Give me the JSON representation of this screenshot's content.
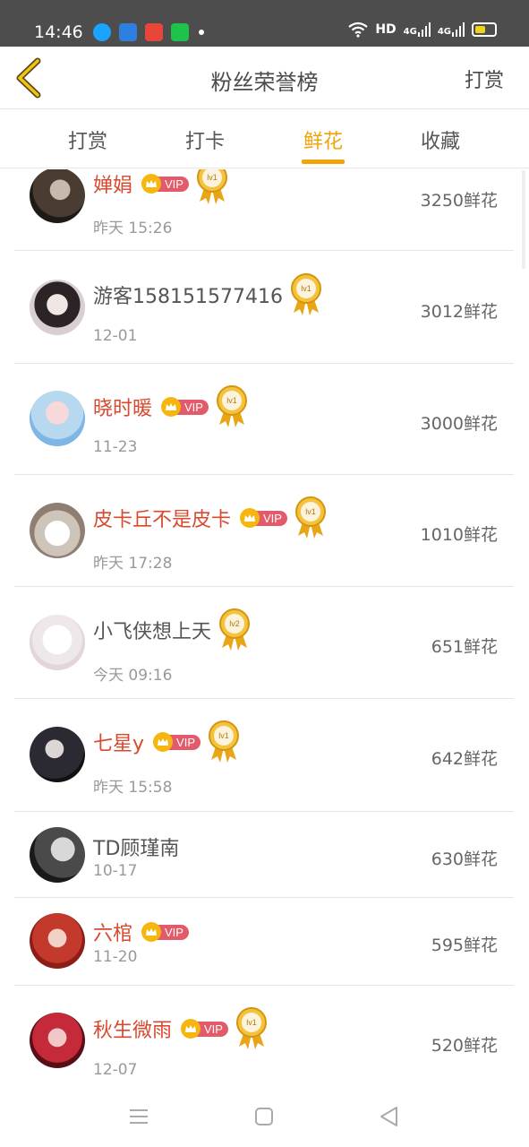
{
  "status_bar": {
    "time": "14:46",
    "hd_label": "HD",
    "net1": "4G",
    "net2": "4G"
  },
  "nav": {
    "title": "粉丝荣誉榜",
    "action_label": "打赏"
  },
  "tabs": [
    {
      "label": "打赏",
      "active": false
    },
    {
      "label": "打卡",
      "active": false
    },
    {
      "label": "鲜花",
      "active": true
    },
    {
      "label": "收藏",
      "active": false
    }
  ],
  "vip_label": "VIP",
  "rows": [
    {
      "name": "婵娟",
      "vip": true,
      "level": "lv1",
      "date": "昨天 15:26",
      "amount": "3250鲜花"
    },
    {
      "name": "游客158151577416",
      "vip": false,
      "level": "lv1",
      "date": "12-01",
      "amount": "3012鲜花"
    },
    {
      "name": "晓时暖",
      "vip": true,
      "level": "lv1",
      "date": "11-23",
      "amount": "3000鲜花"
    },
    {
      "name": "皮卡丘不是皮卡",
      "vip": true,
      "level": "lv1",
      "date": "昨天 17:28",
      "amount": "1010鲜花"
    },
    {
      "name": "小飞侠想上天",
      "vip": false,
      "level": "lv2",
      "date": "今天 09:16",
      "amount": "651鲜花"
    },
    {
      "name": "七星y",
      "vip": true,
      "level": "lv1",
      "date": "昨天 15:58",
      "amount": "642鲜花"
    },
    {
      "name": "TD顾瑾南",
      "vip": false,
      "level": "",
      "date": "10-17",
      "amount": "630鲜花"
    },
    {
      "name": "六棺",
      "vip": true,
      "level": "",
      "date": "11-20",
      "amount": "595鲜花"
    },
    {
      "name": "秋生微雨",
      "vip": true,
      "level": "lv1",
      "date": "12-07",
      "amount": "520鲜花"
    }
  ]
}
